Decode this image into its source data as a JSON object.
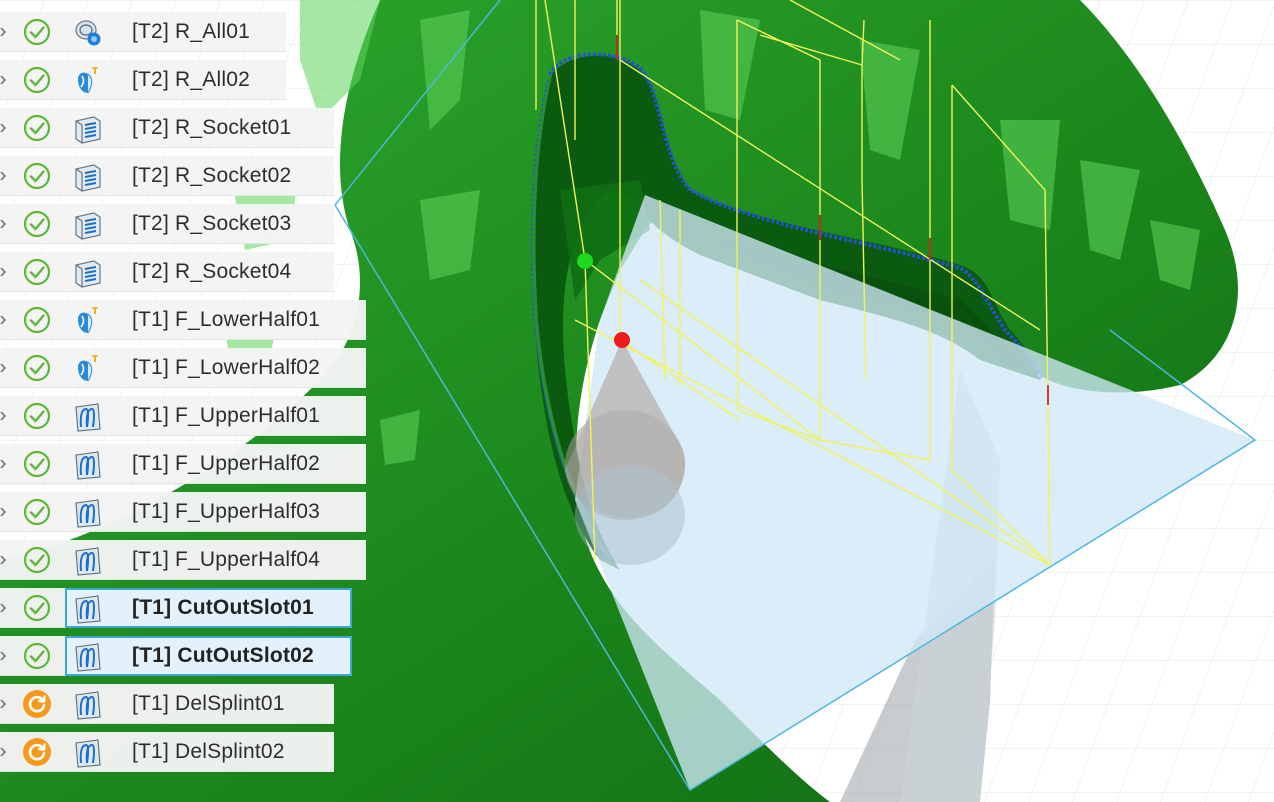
{
  "colors": {
    "model_green": "#1e8c1e",
    "model_dark_green": "#0d6312",
    "highlight_green": "#6ee06a",
    "toolpath_yellow": "#f2f25a",
    "stock_plane_blue": "#cfe8f6",
    "stock_edge_blue": "#4fb6e0",
    "status_ok": "#5fb73a",
    "status_pending": "#f59a1c",
    "selection_blue": "#3fa6d6",
    "start_point_green": "#1ed91e",
    "end_point_red": "#ee1c1c"
  },
  "operations": [
    {
      "label": "[T2] R_All01",
      "status": "check-circle-icon",
      "type": "adaptive-clearing-icon",
      "selected": false
    },
    {
      "label": "[T2] R_All02",
      "status": "check-circle-icon",
      "type": "drill-tool-icon",
      "selected": false
    },
    {
      "label": "[T2] R_Socket01",
      "status": "check-circle-icon",
      "type": "contour-icon",
      "selected": false
    },
    {
      "label": "[T2] R_Socket02",
      "status": "check-circle-icon",
      "type": "contour-icon",
      "selected": false
    },
    {
      "label": "[T2] R_Socket03",
      "status": "check-circle-icon",
      "type": "contour-icon",
      "selected": false
    },
    {
      "label": "[T2] R_Socket04",
      "status": "check-circle-icon",
      "type": "contour-icon",
      "selected": false
    },
    {
      "label": "[T1] F_LowerHalf01",
      "status": "check-circle-icon",
      "type": "drill-tool-icon",
      "selected": false
    },
    {
      "label": "[T1] F_LowerHalf02",
      "status": "check-circle-icon",
      "type": "drill-tool-icon",
      "selected": false
    },
    {
      "label": "[T1] F_UpperHalf01",
      "status": "check-circle-icon",
      "type": "swarf-icon",
      "selected": false
    },
    {
      "label": "[T1] F_UpperHalf02",
      "status": "check-circle-icon",
      "type": "swarf-icon",
      "selected": false
    },
    {
      "label": "[T1] F_UpperHalf03",
      "status": "check-circle-icon",
      "type": "swarf-icon",
      "selected": false
    },
    {
      "label": "[T1] F_UpperHalf04",
      "status": "check-circle-icon",
      "type": "swarf-icon",
      "selected": false
    },
    {
      "label": "[T1] CutOutSlot01",
      "status": "check-circle-icon",
      "type": "swarf-icon",
      "selected": true
    },
    {
      "label": "[T1] CutOutSlot02",
      "status": "check-circle-icon",
      "type": "swarf-icon",
      "selected": true
    },
    {
      "label": "[T1] DelSplint01",
      "status": "regenerate-pending-icon",
      "type": "swarf-icon",
      "selected": false
    },
    {
      "label": "[T1] DelSplint02",
      "status": "regenerate-pending-icon",
      "type": "swarf-icon",
      "selected": false
    }
  ]
}
